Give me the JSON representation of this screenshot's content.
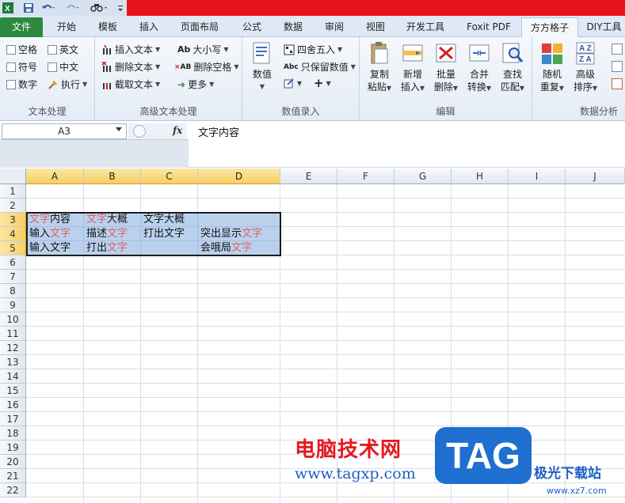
{
  "tabs": [
    {
      "label": "文件"
    },
    {
      "label": "开始"
    },
    {
      "label": "模板"
    },
    {
      "label": "插入"
    },
    {
      "label": "页面布局"
    },
    {
      "label": "公式"
    },
    {
      "label": "数据"
    },
    {
      "label": "审阅"
    },
    {
      "label": "视图"
    },
    {
      "label": "开发工具"
    },
    {
      "label": "Foxit PDF"
    },
    {
      "label": "方方格子"
    },
    {
      "label": "DIY工具"
    }
  ],
  "ribbon": {
    "text_process": {
      "checks": [
        "空格",
        "英文",
        "符号",
        "中文",
        "数字"
      ],
      "exec_label": "执行",
      "group_label": "文本处理"
    },
    "advanced_text": {
      "insert_text": "插入文本",
      "delete_text": "删除文本",
      "extract_text": "截取文本",
      "case": "大小写",
      "delete_space": "删除空格",
      "more": "更多",
      "group_label": "高级文本处理"
    },
    "number_entry": {
      "value_label": "数值",
      "round_label": "四舍五入",
      "keep_value_label": "只保留数值",
      "group_label": "数值录入"
    },
    "edit": {
      "copy_paste": [
        "复制",
        "粘贴"
      ],
      "new_insert": [
        "新增",
        "插入"
      ],
      "batch_delete": [
        "批量",
        "删除"
      ],
      "merge_convert": [
        "合并",
        "转换"
      ],
      "find_match": [
        "查找",
        "匹配"
      ],
      "group_label": "编辑"
    },
    "analysis": {
      "random_repeat": [
        "随机",
        "重复"
      ],
      "advanced_sort": [
        "高级",
        "排序"
      ],
      "group_label": "数据分析"
    }
  },
  "formula_bar": {
    "name_box": "A3",
    "fx": "fx",
    "content": "文字内容"
  },
  "columns": [
    "A",
    "B",
    "C",
    "D",
    "E",
    "F",
    "G",
    "H",
    "I",
    "J"
  ],
  "rows": [
    "1",
    "2",
    "3",
    "4",
    "5",
    "6",
    "7",
    "8",
    "9",
    "10",
    "11",
    "12",
    "13",
    "14",
    "15",
    "16",
    "17",
    "18",
    "19",
    "20",
    "21",
    "22"
  ],
  "cells": {
    "A3": {
      "hl": "文字",
      "rest": "内容"
    },
    "B3": {
      "hl": "文字",
      "rest": "大概"
    },
    "C3": {
      "text": "文字大概"
    },
    "A4": {
      "pre": "输入",
      "hl": "文字"
    },
    "B4": {
      "pre": "描述",
      "hl": "文字"
    },
    "C4": {
      "text": "打出文字"
    },
    "D4": {
      "pre": "突出显示",
      "hl": "文字"
    },
    "A5": {
      "text": "输入文字"
    },
    "B5": {
      "pre": "打出",
      "hl": "文字"
    },
    "D5": {
      "pre": "会哦局",
      "hl": "文字"
    }
  },
  "watermark": {
    "title": "电脑技术网",
    "url": "www.tagxp.com",
    "badge": "TAG",
    "site": "极光下载站",
    "site_url": "www.xz7.com"
  },
  "colors": {
    "file_tab": "#2b8a3e",
    "titlebar_red": "#e8141c",
    "highlight_text": "#e06060",
    "selection": "#6699d6"
  }
}
